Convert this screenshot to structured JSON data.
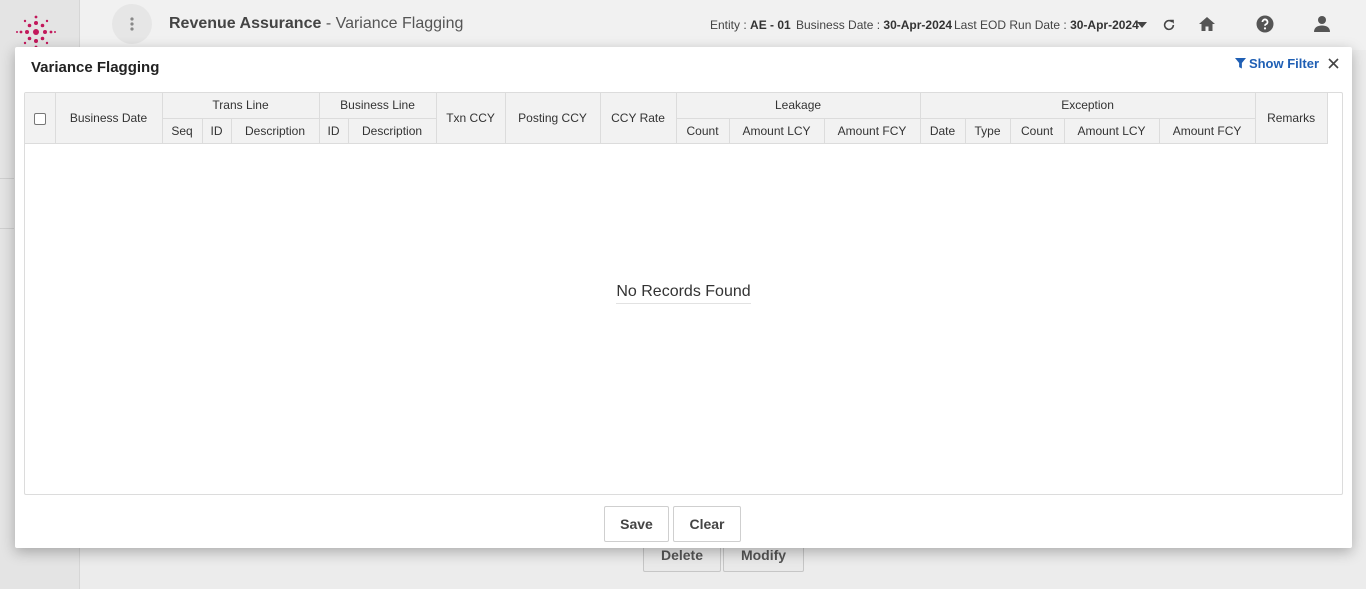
{
  "header": {
    "module": "Revenue Assurance",
    "separator": " - ",
    "screen": "Variance Flagging",
    "entity_label": "Entity :",
    "entity_value": "AE - 01",
    "business_date_label": "Business Date :",
    "business_date_value": "30-Apr-2024",
    "eod_label": "Last EOD Run Date :",
    "eod_value": "30-Apr-2024",
    "icons": [
      "menu-kebab-icon",
      "chevron-down-icon",
      "refresh-icon",
      "home-icon",
      "help-icon",
      "user-icon"
    ]
  },
  "background_buttons": {
    "delete": "Delete",
    "modify": "Modify"
  },
  "modal": {
    "title": "Variance Flagging",
    "show_filter": "Show Filter",
    "columns": {
      "business_date": "Business Date",
      "trans_line": "Trans Line",
      "trans_seq": "Seq",
      "trans_id": "ID",
      "trans_desc": "Description",
      "business_line": "Business Line",
      "bl_id": "ID",
      "bl_desc": "Description",
      "txn_ccy": "Txn CCY",
      "posting_ccy": "Posting CCY",
      "ccy_rate": "CCY Rate",
      "leakage": "Leakage",
      "leak_count": "Count",
      "leak_amount_lcy": "Amount LCY",
      "leak_amount_fcy": "Amount FCY",
      "exception": "Exception",
      "exc_date": "Date",
      "exc_type": "Type",
      "exc_count": "Count",
      "exc_amount_lcy": "Amount LCY",
      "exc_amount_fcy": "Amount FCY",
      "remarks": "Remarks"
    },
    "empty_message": "No Records Found",
    "save": "Save",
    "clear": "Clear"
  },
  "colors": {
    "accent": "#1f5fb4",
    "logo": "#c2185b"
  }
}
